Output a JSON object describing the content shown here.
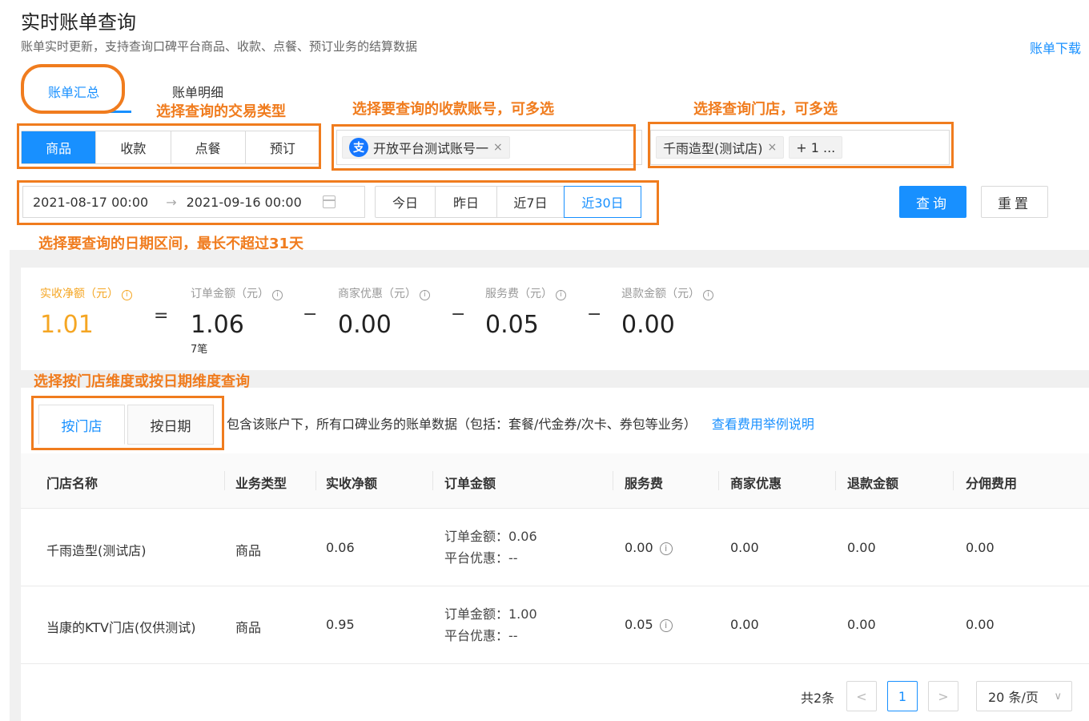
{
  "header": {
    "title": "实时账单查询",
    "subtitle": "账单实时更新，支持查询口碑平台商品、收款、点餐、预订业务的结算数据",
    "download_link": "账单下载"
  },
  "tabs": {
    "summary": "账单汇总",
    "detail": "账单明细"
  },
  "annotations": {
    "trade_type": "选择查询的交易类型",
    "account": "选择要查询的收款账号，可多选",
    "store": "选择查询门店，可多选",
    "date": "选择要查询的日期区间，最长不超过31天",
    "dimension": "选择按门店维度或按日期维度查询"
  },
  "trade_types": [
    "商品",
    "收款",
    "点餐",
    "预订"
  ],
  "account_select": {
    "chip_label": "开放平台测试账号一",
    "icon_char": "支"
  },
  "store_select": {
    "chip_label": "千雨造型(测试店)",
    "more_label": "+ 1 ..."
  },
  "date_range": {
    "start": "2021-08-17 00:00",
    "end": "2021-09-16 00:00",
    "arrow": "→"
  },
  "quick_dates": [
    "今日",
    "昨日",
    "近7日",
    "近30日"
  ],
  "buttons": {
    "query": "查询",
    "reset": "重置"
  },
  "stats": {
    "net": {
      "label": "实收净额（元）",
      "value": "1.01"
    },
    "order": {
      "label": "订单金额（元）",
      "value": "1.06",
      "count": "7笔"
    },
    "merchant_discount": {
      "label": "商家优惠（元）",
      "value": "0.00"
    },
    "service_fee": {
      "label": "服务费（元）",
      "value": "0.05"
    },
    "refund": {
      "label": "退款金额（元）",
      "value": "0.00"
    },
    "op_equals": "=",
    "op_minus": "−",
    "info": "i"
  },
  "dimension_tabs": {
    "by_store": "按门店",
    "by_date": "按日期",
    "description": "包含该账户下，所有口碑业务的账单数据（包括：套餐/代金券/次卡、券包等业务）",
    "link": "查看费用举例说明"
  },
  "table": {
    "columns": [
      "门店名称",
      "业务类型",
      "实收净额",
      "订单金额",
      "服务费",
      "商家优惠",
      "退款金额",
      "分佣费用"
    ],
    "rows": [
      {
        "store": "千雨造型(测试店)",
        "type": "商品",
        "net": "0.06",
        "order_line": "订单金额：0.06",
        "platform_line": "平台优惠：--",
        "service": "0.00",
        "merchant": "0.00",
        "refund": "0.00",
        "commission": "0.00"
      },
      {
        "store": "当康的KTV门店(仅供测试)",
        "type": "商品",
        "net": "0.95",
        "order_line": "订单金额：1.00",
        "platform_line": "平台优惠：--",
        "service": "0.05",
        "merchant": "0.00",
        "refund": "0.00",
        "commission": "0.00"
      }
    ]
  },
  "pagination": {
    "total": "共2条",
    "prev": "<",
    "current": "1",
    "next": ">",
    "page_size": "20 条/页",
    "dropdown_arrow": "∨"
  },
  "colors": {
    "primary": "#1890ff",
    "annotation": "#f07c1e",
    "net_amount": "#f5a623"
  }
}
